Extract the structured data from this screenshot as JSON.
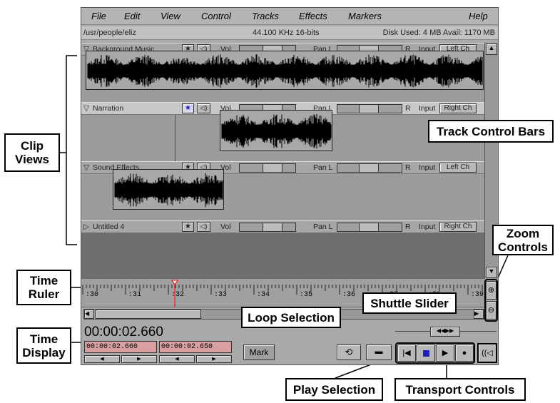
{
  "menu": [
    "File",
    "Edit",
    "View",
    "Control",
    "Tracks",
    "Effects",
    "Markers",
    "Help"
  ],
  "info": {
    "path": "/usr/people/eliz",
    "format": "44.100 KHz  16-bits",
    "disk": "Disk Used: 4 MB Avail: 1170 MB"
  },
  "tracks": [
    {
      "name": "Background Music",
      "vol": "Vol",
      "pan_l": "Pan L",
      "pan_r": "R",
      "input": "Input",
      "channel": "Left Ch",
      "expanded": true,
      "selected": false
    },
    {
      "name": "Narration",
      "vol": "Vol",
      "pan_l": "Pan L",
      "pan_r": "R",
      "input": "Input",
      "channel": "Right Ch",
      "expanded": true,
      "selected": true
    },
    {
      "name": "Sound Effects",
      "vol": "Vol",
      "pan_l": "Pan L",
      "pan_r": "R",
      "input": "Input",
      "channel": "Left Ch",
      "expanded": true,
      "selected": false
    },
    {
      "name": "Untitled 4",
      "vol": "Vol",
      "pan_l": "Pan L",
      "pan_r": "R",
      "input": "Input",
      "channel": "Right Ch",
      "expanded": false,
      "selected": false
    }
  ],
  "ruler": [
    ":30",
    ":31",
    ":32",
    ":33",
    ":34",
    ":35",
    ":36",
    ":37",
    ":38",
    ":39",
    ":40",
    ":41"
  ],
  "time_display": "00:00:02.660",
  "sel_start": "00:00:02.660",
  "sel_end": "00:00:02.650",
  "mark_label": "Mark",
  "colors": {
    "cursor": "#ff0000",
    "stop": "#2020c0",
    "field": "#d8a0a0"
  },
  "callouts": {
    "clip_views": "Clip Views",
    "track_control_bars": "Track Control Bars",
    "zoom_controls": "Zoom Controls",
    "time_ruler": "Time Ruler",
    "time_display": "Time Display",
    "loop_selection": "Loop Selection",
    "shuttle_slider": "Shuttle Slider",
    "play_selection": "Play Selection",
    "transport_controls": "Transport Controls"
  }
}
